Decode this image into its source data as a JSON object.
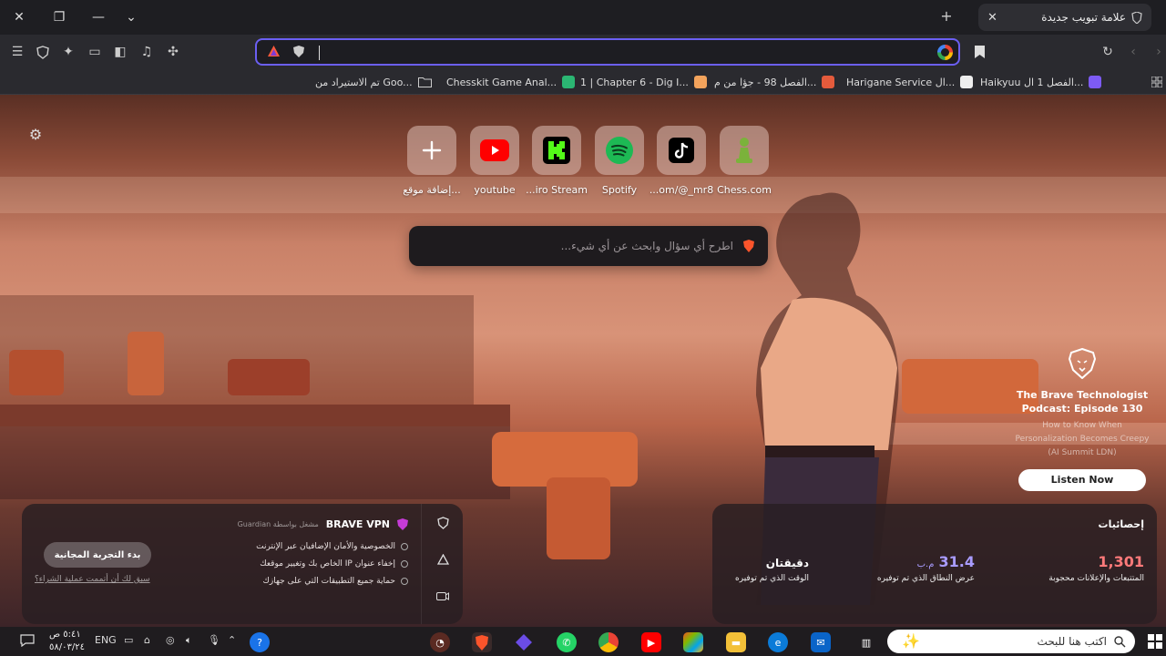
{
  "window": {
    "tab_title": "علامة تبويب جديدة"
  },
  "toolbar": {
    "address_value": ""
  },
  "bookmarks": [
    {
      "label": "Haikyuu الفصل 1 ال...",
      "color": "#7d5bf5"
    },
    {
      "label": "Harigane Service ال...",
      "color": "#ffffff"
    },
    {
      "label": "الفصل 98 - جؤا من م...",
      "color": "#e45b3c"
    },
    {
      "label": "1 | Chapter 6 - Dig I...",
      "color": "#f3a35c"
    },
    {
      "label": "Chesskit Game Anal...",
      "color": "#2bb673"
    },
    {
      "label": "تم الاستيراد من Goo...",
      "color": "#cccccc"
    }
  ],
  "ntp": {
    "tiles": [
      {
        "label": "Chess.com",
        "icon": "chess-pawn-icon",
        "color": "#7bb23b"
      },
      {
        "label": "...om/@_mr8",
        "icon": "tiktok-icon",
        "color": "#000000"
      },
      {
        "label": "Spotify",
        "icon": "spotify-icon",
        "color": "#1db954"
      },
      {
        "label": "...iro Stream",
        "icon": "kick-icon",
        "color": "#53fc18"
      },
      {
        "label": "youtube",
        "icon": "youtube-icon",
        "color": "#ff0000"
      },
      {
        "label": "إضافة موقع...",
        "icon": "plus-icon",
        "color": "#ffffff"
      }
    ],
    "search_placeholder": "اطرح أي سؤال وابحث عن أي شيء...",
    "podcast": {
      "title": "The Brave Technologist Podcast: Episode 130",
      "subtitle": "How to Know When Personalization Becomes Creepy (AI Summit LDN)",
      "button": "Listen Now"
    },
    "vpn": {
      "title": "BRAVE VPN",
      "powered": "مشغل بواسطة Guardian",
      "features": [
        "الخصوصية والأمان الإضافيان عبر الإنترنت",
        "إخفاء عنوان IP الخاص بك وتغيير موقعك",
        "حماية جميع التطبيقات التي على جهازك"
      ],
      "trial_button": "بدء التجربة المجانية",
      "restore_link": "سبق لك أن أتممت عملية الشراء؟"
    },
    "stats": {
      "title": "إحصائيات",
      "items": [
        {
          "value": "1,301",
          "unit": "",
          "label": "المتتبعات والإعلانات محجوبة",
          "color": "#ff7a7a"
        },
        {
          "value": "31.4",
          "unit": "م.ب",
          "label": "عرض النطاق الذي تم توفيره",
          "color": "#a99cff"
        },
        {
          "value": "دقيقتان",
          "unit": "",
          "label": "الوقت الذي تم توفيره",
          "color": "#ffffff"
        }
      ]
    }
  },
  "taskbar": {
    "search_placeholder": "اكتب هنا للبحث",
    "language": "ENG",
    "time": "٥:٤١ ص",
    "date": "٥٨/٠٣/٢٤"
  }
}
